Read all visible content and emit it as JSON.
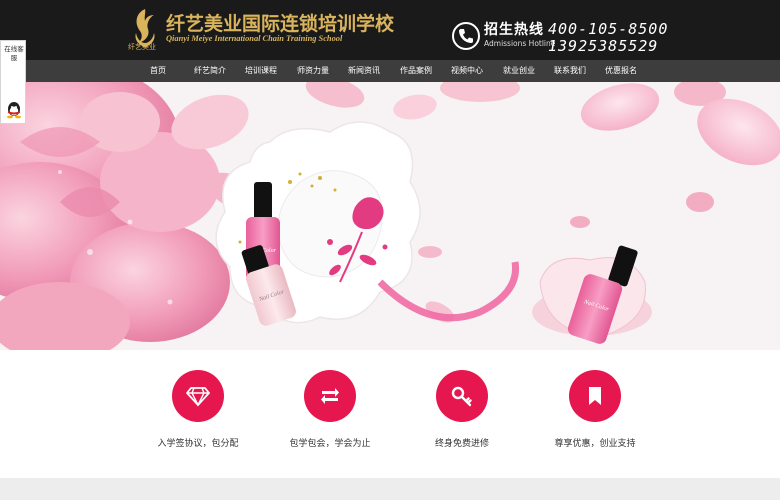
{
  "header": {
    "logo_cn": "纤艺美业国际连锁培训学校",
    "logo_en": "Qianyi Meiye International Chain Training School",
    "logo_small": "纤艺美业",
    "hotline_label": "招生热线",
    "hotline_en": "Admissions Hotline",
    "phone1": "400-105-8500",
    "phone2": "13925385529",
    "accent": "#d9b45c"
  },
  "nav": {
    "items": [
      {
        "label": "首页"
      },
      {
        "label": "纤艺简介"
      },
      {
        "label": "培训课程"
      },
      {
        "label": "师资力量"
      },
      {
        "label": "新闻资讯"
      },
      {
        "label": "作品案例"
      },
      {
        "label": "视频中心"
      },
      {
        "label": "就业创业"
      },
      {
        "label": "联系我们"
      },
      {
        "label": "优惠报名"
      }
    ]
  },
  "side_widget": {
    "text": "在线客服",
    "icon": "qq-icon"
  },
  "banner": {
    "bottle_text": "Nail Color"
  },
  "features": {
    "accent": "#e5174e",
    "items": [
      {
        "label": "入学签协议，包分配",
        "icon": "diamond-icon"
      },
      {
        "label": "包学包会，学会为止",
        "icon": "repeat-icon"
      },
      {
        "label": "终身免费进修",
        "icon": "key-icon"
      },
      {
        "label": "尊享优惠，创业支持",
        "icon": "bookmark-icon"
      }
    ]
  }
}
